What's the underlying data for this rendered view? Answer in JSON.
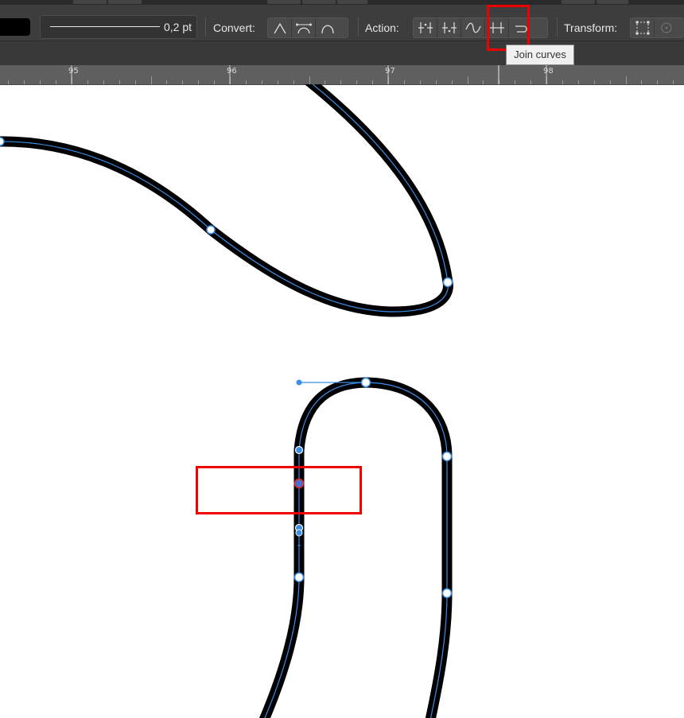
{
  "toolbar": {
    "stroke_width": "0,2 pt",
    "convert_label": "Convert:",
    "action_label": "Action:",
    "transform_label": "Transform:",
    "convert_buttons": [
      "convert-sharp",
      "convert-smooth",
      "convert-smart"
    ],
    "action_buttons": [
      "break-curve",
      "close-curve",
      "smooth-curve",
      "join-curves",
      "reverse-curve"
    ]
  },
  "tooltip": "Join curves",
  "ruler": {
    "ticks": [
      "95",
      "96",
      "97",
      "98"
    ]
  },
  "colors": {
    "toolbar_bg": "#3d3d3d",
    "ruler_bg": "#5f5f5f",
    "curve_stroke": "#000000",
    "path_line": "#3a8ee6",
    "highlight": "#ee0000"
  }
}
